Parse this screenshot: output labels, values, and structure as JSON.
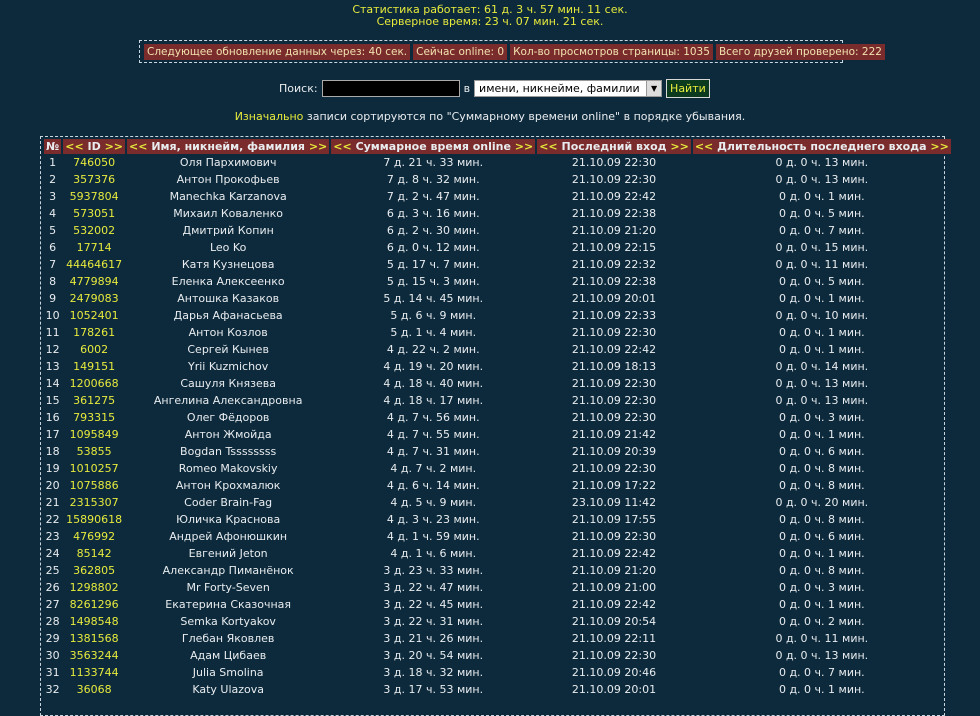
{
  "status": {
    "uptime": "Статистика работает: 61 д. 3 ч. 57 мин. 11 сек.",
    "server_time": "Серверное время: 23 ч. 07 мин. 21 сек."
  },
  "infobar": {
    "next_update": "Следующее обновление данных через: 40 сек.",
    "online_now": "Сейчас online: 0",
    "page_views": "Кол-во просмотров страницы: 1035",
    "friends_checked": "Всего друзей проверено: 222"
  },
  "search": {
    "label": "Поиск:",
    "value": "",
    "in_label": "в",
    "select_value": "имени, никнейме, фамилии",
    "button": "Найти"
  },
  "note": {
    "highlight": "Изначально",
    "text": " записи сортируются по \"Суммарному времени online\" в порядке убывания."
  },
  "table": {
    "headers": [
      "№",
      "ID",
      "Имя, никнейм, фамилия",
      "Суммарное время online",
      "Последний вход",
      "Длительность последнего входа"
    ],
    "arrow_left": "<<",
    "arrow_right": ">>",
    "rows": [
      [
        "1",
        "746050",
        "Оля Пархимович",
        "7 д. 21 ч. 33 мин.",
        "21.10.09 22:30",
        "0 д. 0 ч. 13 мин."
      ],
      [
        "2",
        "357376",
        "Антон Прокофьев",
        "7 д. 8 ч. 32 мин.",
        "21.10.09 22:30",
        "0 д. 0 ч. 13 мин."
      ],
      [
        "3",
        "5937804",
        "Manechka Karzanova",
        "7 д. 2 ч. 47 мин.",
        "21.10.09 22:42",
        "0 д. 0 ч. 1 мин."
      ],
      [
        "4",
        "573051",
        "Михаил Коваленко",
        "6 д. 3 ч. 16 мин.",
        "21.10.09 22:38",
        "0 д. 0 ч. 5 мин."
      ],
      [
        "5",
        "532002",
        "Дмитрий Копин",
        "6 д. 2 ч. 30 мин.",
        "21.10.09 21:20",
        "0 д. 0 ч. 7 мин."
      ],
      [
        "6",
        "17714",
        "Leo Ko",
        "6 д. 0 ч. 12 мин.",
        "21.10.09 22:15",
        "0 д. 0 ч. 15 мин."
      ],
      [
        "7",
        "44464617",
        "Катя Кузнецова",
        "5 д. 17 ч. 7 мин.",
        "21.10.09 22:32",
        "0 д. 0 ч. 11 мин."
      ],
      [
        "8",
        "4779894",
        "Еленка Алексеенко",
        "5 д. 15 ч. 3 мин.",
        "21.10.09 22:38",
        "0 д. 0 ч. 5 мин."
      ],
      [
        "9",
        "2479083",
        "Антошка Казаков",
        "5 д. 14 ч. 45 мин.",
        "21.10.09 20:01",
        "0 д. 0 ч. 1 мин."
      ],
      [
        "10",
        "1052401",
        "Дарья Афанасьева",
        "5 д. 6 ч. 9 мин.",
        "21.10.09 22:33",
        "0 д. 0 ч. 10 мин."
      ],
      [
        "11",
        "178261",
        "Антон Козлов",
        "5 д. 1 ч. 4 мин.",
        "21.10.09 22:30",
        "0 д. 0 ч. 1 мин."
      ],
      [
        "12",
        "6002",
        "Сергей Кынев",
        "4 д. 22 ч. 2 мин.",
        "21.10.09 22:42",
        "0 д. 0 ч. 1 мин."
      ],
      [
        "13",
        "149151",
        "Yrii Kuzmichov",
        "4 д. 19 ч. 20 мин.",
        "21.10.09 18:13",
        "0 д. 0 ч. 14 мин."
      ],
      [
        "14",
        "1200668",
        "Сашуля Князева",
        "4 д. 18 ч. 40 мин.",
        "21.10.09 22:30",
        "0 д. 0 ч. 13 мин."
      ],
      [
        "15",
        "361275",
        "Ангелина Александровна",
        "4 д. 18 ч. 17 мин.",
        "21.10.09 22:30",
        "0 д. 0 ч. 13 мин."
      ],
      [
        "16",
        "793315",
        "Олег Фёдоров",
        "4 д. 7 ч. 56 мин.",
        "21.10.09 22:30",
        "0 д. 0 ч. 3 мин."
      ],
      [
        "17",
        "1095849",
        "Антон Жмойда",
        "4 д. 7 ч. 55 мин.",
        "21.10.09 21:42",
        "0 д. 0 ч. 1 мин."
      ],
      [
        "18",
        "53855",
        "Bogdan Tssssssss",
        "4 д. 7 ч. 31 мин.",
        "21.10.09 20:39",
        "0 д. 0 ч. 6 мин."
      ],
      [
        "19",
        "1010257",
        "Romeo Makovskiy",
        "4 д. 7 ч. 2 мин.",
        "21.10.09 22:30",
        "0 д. 0 ч. 8 мин."
      ],
      [
        "20",
        "1075886",
        "Антон Крохмалюк",
        "4 д. 6 ч. 14 мин.",
        "21.10.09 17:22",
        "0 д. 0 ч. 8 мин."
      ],
      [
        "21",
        "2315307",
        "Coder Brain-Fag",
        "4 д. 5 ч. 9 мин.",
        "23.10.09 11:42",
        "0 д. 0 ч. 20 мин."
      ],
      [
        "22",
        "15890618",
        "Юличка Краснова",
        "4 д. 3 ч. 23 мин.",
        "21.10.09 17:55",
        "0 д. 0 ч. 8 мин."
      ],
      [
        "23",
        "476992",
        "Андрей Афонюшкин",
        "4 д. 1 ч. 59 мин.",
        "21.10.09 22:30",
        "0 д. 0 ч. 6 мин."
      ],
      [
        "24",
        "85142",
        "Евгений Jeton",
        "4 д. 1 ч. 6 мин.",
        "21.10.09 22:42",
        "0 д. 0 ч. 1 мин."
      ],
      [
        "25",
        "362805",
        "Александр Пиманёнок",
        "3 д. 23 ч. 33 мин.",
        "21.10.09 21:20",
        "0 д. 0 ч. 8 мин."
      ],
      [
        "26",
        "1298802",
        "Mr Forty-Seven",
        "3 д. 22 ч. 47 мин.",
        "21.10.09 21:00",
        "0 д. 0 ч. 3 мин."
      ],
      [
        "27",
        "8261296",
        "Екатерина Сказочная",
        "3 д. 22 ч. 45 мин.",
        "21.10.09 22:42",
        "0 д. 0 ч. 1 мин."
      ],
      [
        "28",
        "1498548",
        "Semka Kortyakov",
        "3 д. 22 ч. 31 мин.",
        "21.10.09 20:54",
        "0 д. 0 ч. 2 мин."
      ],
      [
        "29",
        "1381568",
        "Глебан Яковлев",
        "3 д. 21 ч. 26 мин.",
        "21.10.09 22:11",
        "0 д. 0 ч. 11 мин."
      ],
      [
        "30",
        "3563244",
        "Адам Цибаев",
        "3 д. 20 ч. 54 мин.",
        "21.10.09 22:30",
        "0 д. 0 ч. 13 мин."
      ],
      [
        "31",
        "1133744",
        "Julia Smolina",
        "3 д. 18 ч. 32 мин.",
        "21.10.09 20:46",
        "0 д. 0 ч. 7 мин."
      ],
      [
        "32",
        "36068",
        "Katy Ulazova",
        "3 д. 17 ч. 53 мин.",
        "21.10.09 20:01",
        "0 д. 0 ч. 1 мин."
      ]
    ]
  }
}
